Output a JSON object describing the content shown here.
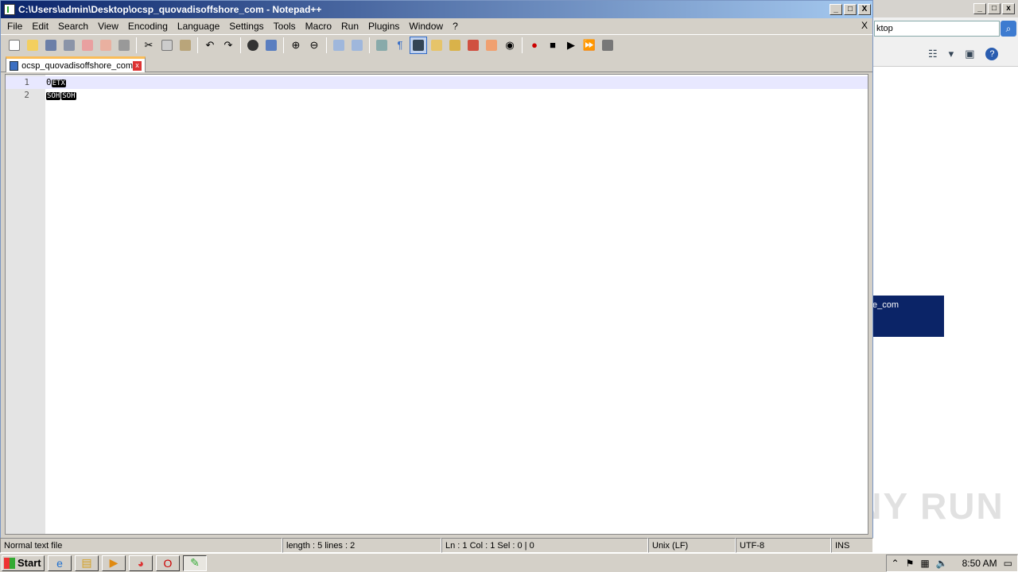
{
  "window": {
    "title": "C:\\Users\\admin\\Desktop\\ocsp_quovadisoffshore_com - Notepad++",
    "minimize": "_",
    "maximize": "□",
    "close": "X"
  },
  "menu": {
    "items": [
      "File",
      "Edit",
      "Search",
      "View",
      "Encoding",
      "Language",
      "Settings",
      "Tools",
      "Macro",
      "Run",
      "Plugins",
      "Window",
      "?"
    ],
    "close_doc": "X"
  },
  "tab": {
    "label": "ocsp_quovadisoffshore_com",
    "close": "x"
  },
  "editor": {
    "lines": [
      {
        "num": "1",
        "prefix": "0",
        "tokens": [
          "ETX"
        ]
      },
      {
        "num": "2",
        "prefix": "",
        "tokens": [
          "SOH",
          "SOH"
        ]
      }
    ]
  },
  "status": {
    "file_type": "Normal text file",
    "length": "length : 5    lines : 2",
    "position": "Ln : 1    Col : 1    Sel : 0 | 0",
    "eol": "Unix (LF)",
    "encoding": "UTF-8",
    "mode": "INS"
  },
  "background_window": {
    "search_text": "ktop",
    "selected_item": "e_com"
  },
  "watermark": "ANY RUN",
  "taskbar": {
    "start": "Start",
    "clock": "8:50 AM"
  },
  "icons": {
    "search": "search-icon",
    "help": "help-icon",
    "flag": "flag-icon"
  }
}
